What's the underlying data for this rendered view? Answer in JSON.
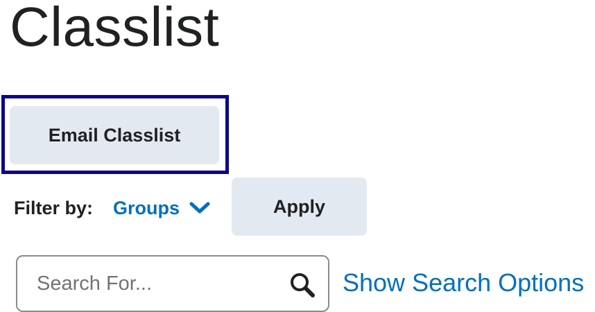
{
  "page": {
    "title": "Classlist"
  },
  "toolbar": {
    "email_label": "Email Classlist"
  },
  "filter": {
    "label": "Filter by:",
    "selected": "Groups",
    "apply_label": "Apply"
  },
  "search": {
    "placeholder": "Search For...",
    "value": "",
    "options_link": "Show Search Options"
  },
  "icons": {
    "dropdown": "chevron-down-icon",
    "search": "search-icon"
  },
  "colors": {
    "focus_ring": "#0a068f",
    "link": "#006fbf",
    "button_bg": "#e3e9f1",
    "text": "#202122"
  }
}
